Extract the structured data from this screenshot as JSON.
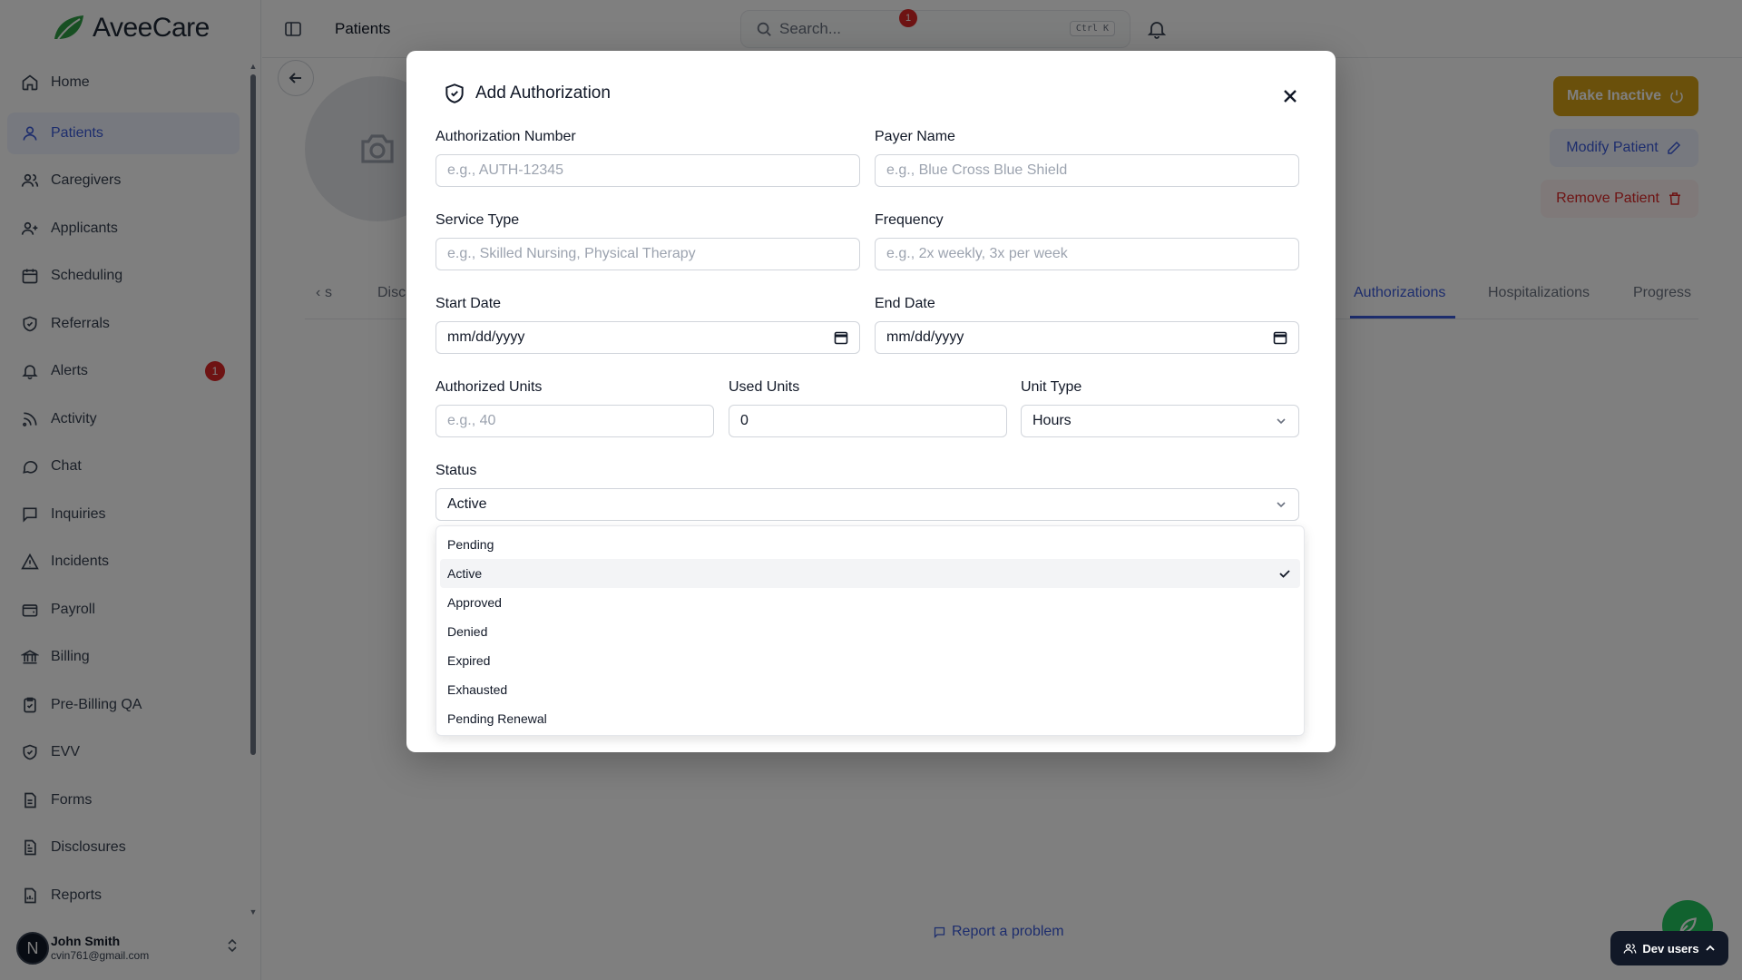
{
  "app": {
    "name": "AveeCare"
  },
  "sidebar": {
    "items": [
      {
        "label": "Home",
        "icon": "home-icon"
      },
      {
        "label": "Patients",
        "icon": "user-icon",
        "active": true
      },
      {
        "label": "Caregivers",
        "icon": "users-icon"
      },
      {
        "label": "Applicants",
        "icon": "user-plus-icon"
      },
      {
        "label": "Scheduling",
        "icon": "calendar-icon"
      },
      {
        "label": "Referrals",
        "icon": "shield-icon"
      },
      {
        "label": "Alerts",
        "icon": "bell-icon",
        "badge": "1"
      },
      {
        "label": "Activity",
        "icon": "rss-icon"
      },
      {
        "label": "Chat",
        "icon": "message-circle-icon"
      },
      {
        "label": "Inquiries",
        "icon": "message-square-icon"
      },
      {
        "label": "Incidents",
        "icon": "alert-triangle-icon"
      },
      {
        "label": "Payroll",
        "icon": "wallet-icon"
      },
      {
        "label": "Billing",
        "icon": "landmark-icon"
      },
      {
        "label": "Pre-Billing QA",
        "icon": "clipboard-check-icon"
      },
      {
        "label": "EVV",
        "icon": "shield-check-icon"
      },
      {
        "label": "Forms",
        "icon": "file-icon"
      },
      {
        "label": "Disclosures",
        "icon": "file-text-icon"
      },
      {
        "label": "Reports",
        "icon": "file-chart-icon"
      }
    ],
    "user": {
      "initial": "N",
      "name": "John Smith",
      "email": "cvin761@gmail.com"
    }
  },
  "topbar": {
    "breadcrumb": "Patients",
    "search_placeholder": "Search...",
    "search_shortcut": "Ctrl K",
    "notification_count": "1"
  },
  "page": {
    "buttons": {
      "make_inactive": "Make Inactive",
      "modify": "Modify Patient",
      "remove": "Remove Patient"
    },
    "tabs": [
      "s",
      "Disc",
      "Authorizations",
      "Hospitalizations",
      "Progress"
    ],
    "active_tab": "Authorizations",
    "report_problem": "Report a problem",
    "dev_users": "Dev users"
  },
  "modal": {
    "title": "Add Authorization",
    "fields": {
      "auth_number": {
        "label": "Authorization Number",
        "placeholder": "e.g., AUTH-12345",
        "value": ""
      },
      "payer_name": {
        "label": "Payer Name",
        "placeholder": "e.g., Blue Cross Blue Shield",
        "value": ""
      },
      "service_type": {
        "label": "Service Type",
        "placeholder": "e.g., Skilled Nursing, Physical Therapy",
        "value": ""
      },
      "frequency": {
        "label": "Frequency",
        "placeholder": "e.g., 2x weekly, 3x per week",
        "value": ""
      },
      "start_date": {
        "label": "Start Date",
        "value": "mm/dd/yyyy"
      },
      "end_date": {
        "label": "End Date",
        "value": "mm/dd/yyyy"
      },
      "authorized_units": {
        "label": "Authorized Units",
        "placeholder": "e.g., 40",
        "value": ""
      },
      "used_units": {
        "label": "Used Units",
        "value": "0"
      },
      "unit_type": {
        "label": "Unit Type",
        "value": "Hours"
      },
      "status": {
        "label": "Status",
        "value": "Active"
      }
    },
    "status_options": [
      "Pending",
      "Active",
      "Approved",
      "Denied",
      "Expired",
      "Exhausted",
      "Pending Renewal"
    ],
    "selected_status": "Active"
  },
  "colors": {
    "accent": "#3b5bdb",
    "warning": "#d4a017",
    "danger": "#dc2626",
    "success": "#22c55e"
  }
}
